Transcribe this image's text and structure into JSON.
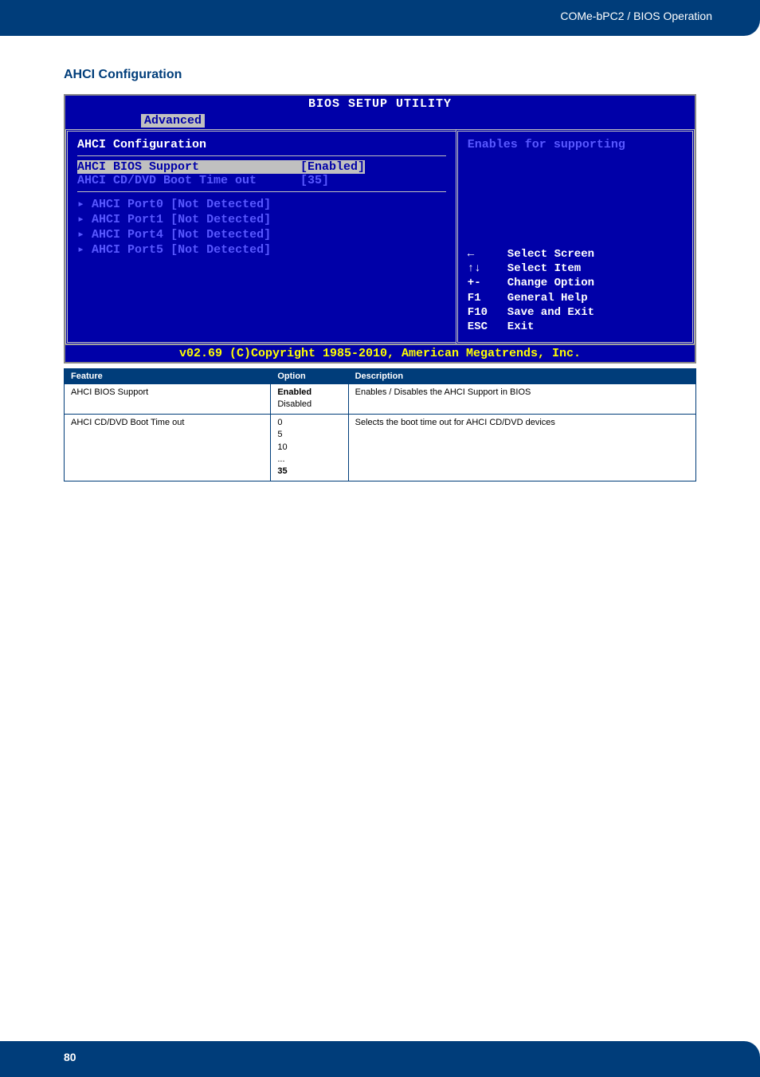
{
  "header": {
    "breadcrumb": "COMe-bPC2 / BIOS Operation"
  },
  "section": {
    "title": "AHCI Configuration"
  },
  "bios": {
    "title": "BIOS SETUP UTILITY",
    "tab": "Advanced",
    "config_header": "AHCI Configuration",
    "items": {
      "bios_support": {
        "label": "AHCI BIOS Support",
        "value": "[Enabled]"
      },
      "boot_timeout": {
        "label": "AHCI CD/DVD Boot Time out",
        "value": "[35]"
      }
    },
    "ports": {
      "p0": "AHCI Port0 [Not Detected]",
      "p1": "AHCI Port1 [Not Detected]",
      "p4": "AHCI Port4 [Not Detected]",
      "p5": "AHCI Port5 [Not Detected]"
    },
    "help_text": "Enables for supporting",
    "help_keys": {
      "k1": {
        "icon": "←",
        "label": "Select Screen"
      },
      "k2": {
        "icon": "↑↓",
        "label": "Select Item"
      },
      "k3": {
        "icon": "+-",
        "label": "Change Option"
      },
      "k4": {
        "icon": "F1",
        "label": "General Help"
      },
      "k5": {
        "icon": "F10",
        "label": "Save and Exit"
      },
      "k6": {
        "icon": "ESC",
        "label": "Exit"
      }
    },
    "footer": "v02.69 (C)Copyright 1985-2010, American Megatrends, Inc."
  },
  "table": {
    "headers": {
      "h1": "Feature",
      "h2": "Option",
      "h3": "Description"
    },
    "rows": {
      "r1": {
        "feature": "AHCI BIOS Support",
        "option_bold": "Enabled",
        "option_rest": "Disabled",
        "description": "Enables / Disables the AHCI Support in BIOS"
      },
      "r2": {
        "feature": "AHCI CD/DVD Boot Time out",
        "option_lines": "0\n5\n10\n...",
        "option_bold": "35",
        "description": "Selects the boot time out for AHCI CD/DVD devices"
      }
    }
  },
  "footer": {
    "page": "80"
  }
}
